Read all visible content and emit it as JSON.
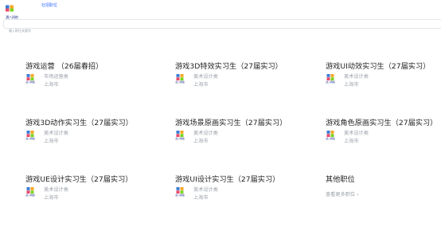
{
  "header": {
    "logo_text": "晨八网络",
    "nav_link": "社招职位"
  },
  "search": {
    "placeholder": "输入职位关键字"
  },
  "jobs": [
    {
      "title": "游戏运营 （26届春招）",
      "company_logo_text": "晨八网络",
      "category": "市场运营类",
      "location": "上海市"
    },
    {
      "title": "游戏3D特效实习生（27届实习）",
      "company_logo_text": "晨八网络",
      "category": "美术设计类",
      "location": "上海市"
    },
    {
      "title": "游戏UI动效实习生（27届实习）",
      "company_logo_text": "晨八网络",
      "category": "美术设计类",
      "location": "上海市"
    },
    {
      "title": "游戏3D动作实习生（27届实习）",
      "company_logo_text": "晨八网络",
      "category": "美术设计类",
      "location": "上海市"
    },
    {
      "title": "游戏场景原画实习生（27届实习）",
      "company_logo_text": "晨八网络",
      "category": "美术设计类",
      "location": "上海市"
    },
    {
      "title": "游戏角色原画实习生（27届实习）",
      "company_logo_text": "晨八网络",
      "category": "美术设计类",
      "location": "上海市"
    },
    {
      "title": "游戏UE设计实习生（27届实习）",
      "company_logo_text": "晨八网络",
      "category": "美术设计类",
      "location": "上海市"
    },
    {
      "title": "游戏UI设计实习生（27届实习）",
      "company_logo_text": "晨八网络",
      "category": "美术设计类",
      "location": "上海市"
    }
  ],
  "other": {
    "title": "其他职位",
    "more_link": "查看更多职位 ›"
  },
  "colors": {
    "link_blue": "#2f6bff",
    "muted_text": "#9aa0a8",
    "title_text": "#1f1f1f",
    "logo_blue": "#2b3b8f"
  }
}
